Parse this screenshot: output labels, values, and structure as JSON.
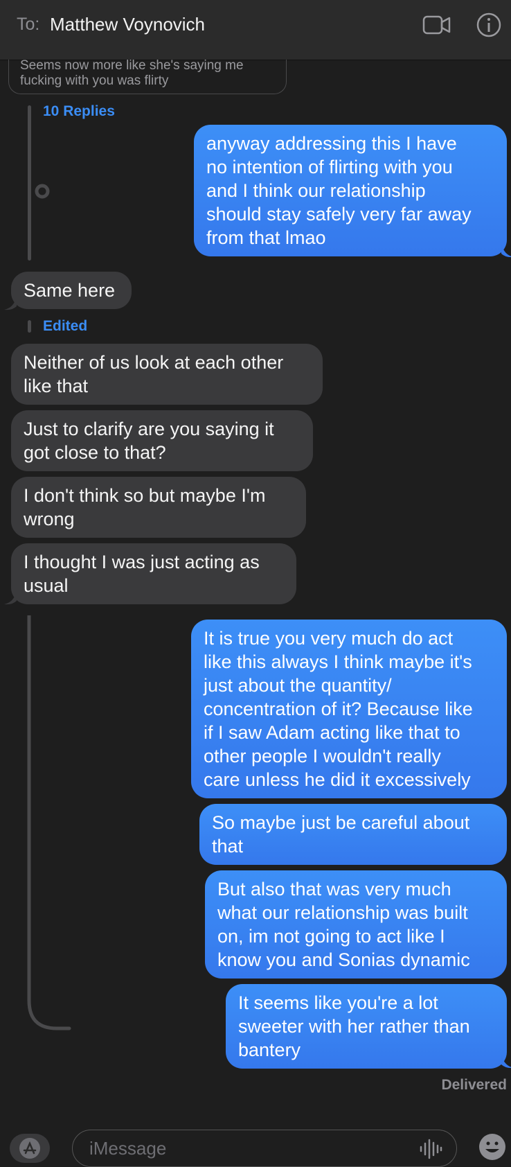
{
  "header": {
    "to_label": "To:",
    "recipient": "Matthew Voynovich",
    "video_icon": "video-camera-icon",
    "info_icon": "info-icon"
  },
  "thread": {
    "quoted_message": "Seems now more like she's saying me fucking with you was flirty",
    "quoted_line1": "Seems now more like she's saying me",
    "quoted_line2": "fucking with you was flirty",
    "replies_label": "10 Replies",
    "edited_label": "Edited"
  },
  "messages": [
    {
      "from": "me",
      "text": "anyway addressing this I have\nno intention of flirting with you\nand I think our relationship\nshould stay safely very far away\nfrom that lmao"
    },
    {
      "from": "them",
      "text": "Same here"
    },
    {
      "from": "them",
      "text": "Neither of us look at each other\nlike that"
    },
    {
      "from": "them",
      "text": "Just to clarify are you saying it\ngot close to that?"
    },
    {
      "from": "them",
      "text": "I don't think so but maybe I'm\nwrong"
    },
    {
      "from": "them",
      "text": "I thought I was just acting as\nusual"
    },
    {
      "from": "me",
      "text": "It is true you very much do act\nlike this always I think maybe it's\njust about the quantity/\nconcentration of it? Because like\nif I saw Adam acting like that to\nother people I wouldn't really\ncare unless he did it excessively"
    },
    {
      "from": "me",
      "text": "So maybe just be careful about\nthat"
    },
    {
      "from": "me",
      "text": "But also that was very much\nwhat our relationship was built\non, im not going to act like I\nknow you and Sonias dynamic"
    },
    {
      "from": "me",
      "text": "It seems like you're a lot\nsweeter with her rather than\nbantery"
    }
  ],
  "status": "Delivered",
  "composer": {
    "placeholder": "iMessage",
    "appstore_icon": "app-store-icon",
    "audio_icon": "audio-waveform-icon",
    "emoji_icon": "emoji-icon"
  },
  "colors": {
    "outgoing": "#3b86f3",
    "incoming": "#3a3a3c",
    "link": "#3b8df5",
    "background": "#1e1e1e"
  }
}
